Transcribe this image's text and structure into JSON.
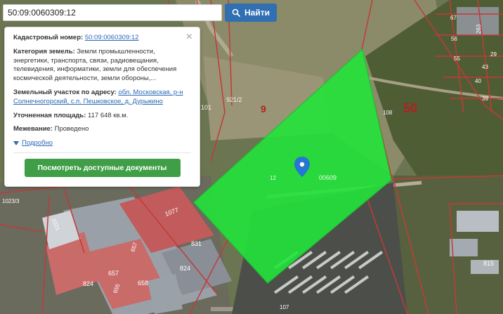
{
  "search": {
    "value": "50:09:0060309:12",
    "button_label": "Найти"
  },
  "info_card": {
    "cadastral_label": "Кадастровый номер:",
    "cadastral_value": "50:09:0060309:12",
    "category_label": "Категория земель:",
    "category_value": "Земли промышленности, энергетики, транспорта, связи, радиовещания, телевидения, информатики, земли для обеспечения космической деятельности, земли обороны,...",
    "address_label": "Земельный участок по адресу:",
    "address_value": "обл. Московская, р-н Солнечногорский, с.п. Пешковское, д. Дурыкино",
    "area_label": "Уточненная площадь:",
    "area_value": "117 648 кв.м.",
    "survey_label": "Межевание:",
    "survey_value": "Проведено",
    "more_label": "Подробно",
    "docs_button": "Посмотреть доступные документы"
  },
  "map_labels": {
    "block_50": "50",
    "plot_9": "9",
    "plot_921_2": "921/2",
    "plot_108": "108",
    "plot_12": "12",
    "plot_00609": "00609",
    "plot_1077": "1077",
    "plot_831": "831",
    "plot_824a": "824",
    "plot_824b": "824",
    "plot_657a": "657",
    "plot_657b": "657",
    "plot_658": "658",
    "plot_655": "655",
    "plot_1021": "1021",
    "plot_1023_3": "1023/3",
    "plot_107": "107",
    "plot_815": "815",
    "plot_263": "263",
    "plot_67": "67",
    "plot_56": "56",
    "plot_55": "55",
    "plot_43": "43",
    "plot_40": "40",
    "plot_39": "39",
    "plot_29": "29",
    "plot_101": "101"
  },
  "colors": {
    "selected_parcel": "#22e33a",
    "parcel_border": "#c33a37",
    "button_blue": "#2f6fb2",
    "button_green": "#3f9e46",
    "pin": "#2776d1"
  }
}
